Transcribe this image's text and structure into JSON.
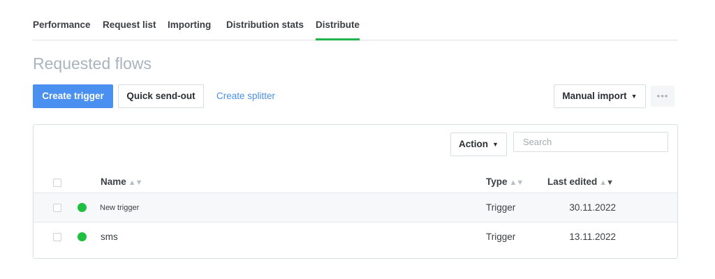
{
  "tabs": [
    {
      "label": "Performance",
      "active": false
    },
    {
      "label": "Request list",
      "active": false
    },
    {
      "label": "Importing",
      "active": false
    },
    {
      "label": "Distribution stats",
      "active": false
    },
    {
      "label": "Distribute",
      "active": true
    }
  ],
  "page_title": "Requested flows",
  "toolbar": {
    "create_trigger": "Create trigger",
    "quick_send_out": "Quick send-out",
    "create_splitter": "Create splitter",
    "manual_import": "Manual import",
    "more": "•••"
  },
  "panel": {
    "action_label": "Action",
    "search_placeholder": "Search",
    "columns": {
      "name": "Name",
      "type": "Type",
      "last_edited": "Last edited"
    },
    "rows": [
      {
        "name": "New trigger",
        "type": "Trigger",
        "last_edited": "30.11.2022",
        "status": "active"
      },
      {
        "name": "sms",
        "type": "Trigger",
        "last_edited": "13.11.2022",
        "status": "active"
      }
    ]
  },
  "colors": {
    "primary": "#4a90f0",
    "active_tab": "#21b44d",
    "status_active": "#1fbf3f",
    "link": "#4a8fe6"
  }
}
